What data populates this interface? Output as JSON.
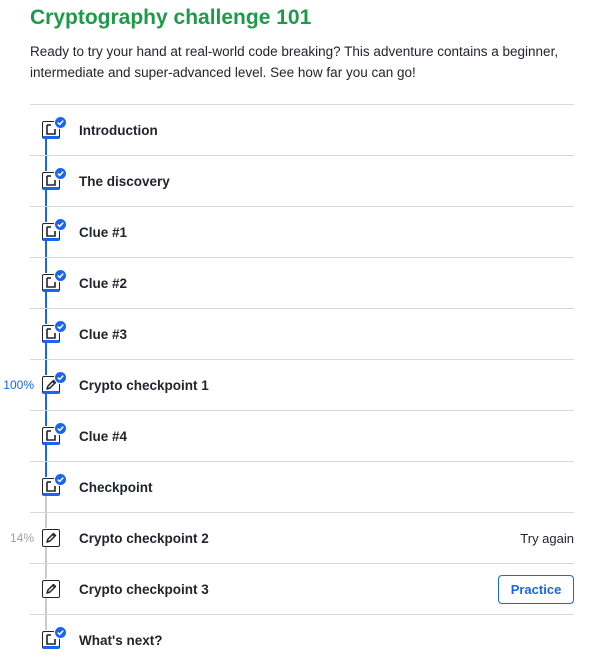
{
  "header": {
    "title": "Cryptography challenge 101",
    "description": "Ready to try your hand at real-world code breaking? This adventure contains a beginner, intermediate and super-advanced level. See how far you can go!"
  },
  "colors": {
    "accent": "#1865f2",
    "title_green": "#1f9a48",
    "text": "#21242c",
    "muted": "#9b9ea5"
  },
  "items": [
    {
      "label": "Introduction",
      "icon": "article-icon",
      "completed": true
    },
    {
      "label": "The discovery",
      "icon": "article-icon",
      "completed": true
    },
    {
      "label": "Clue #1",
      "icon": "article-icon",
      "completed": true
    },
    {
      "label": "Clue #2",
      "icon": "article-icon",
      "completed": true
    },
    {
      "label": "Clue #3",
      "icon": "article-icon",
      "completed": true
    },
    {
      "label": "Crypto checkpoint 1",
      "icon": "exercise-icon",
      "completed": true,
      "progress": "100%"
    },
    {
      "label": "Clue #4",
      "icon": "article-icon",
      "completed": true
    },
    {
      "label": "Checkpoint",
      "icon": "article-icon",
      "completed": true
    },
    {
      "label": "Crypto checkpoint 2",
      "icon": "exercise-icon",
      "completed": false,
      "progress": "14%",
      "status": "Try again"
    },
    {
      "label": "Crypto checkpoint 3",
      "icon": "exercise-icon",
      "completed": false,
      "action": "Practice"
    },
    {
      "label": "What's next?",
      "icon": "article-icon",
      "completed": true
    }
  ]
}
